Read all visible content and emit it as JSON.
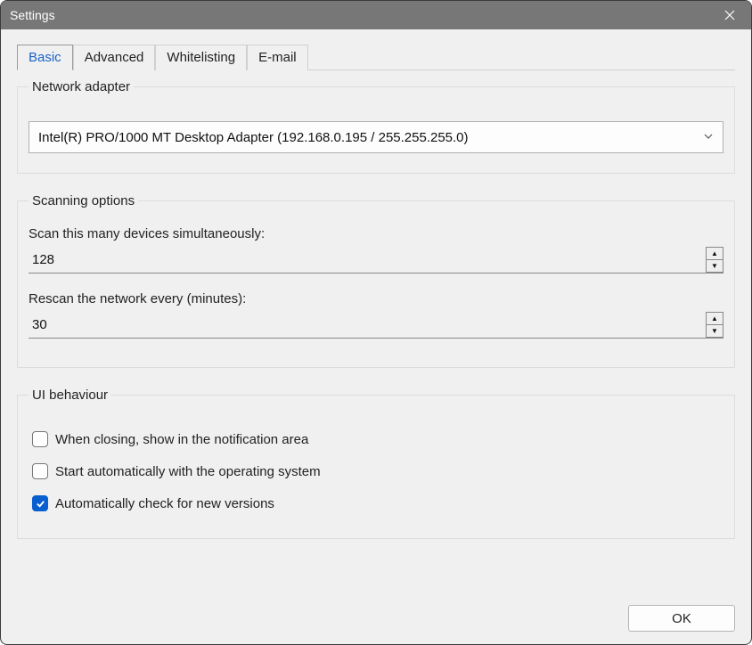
{
  "window": {
    "title": "Settings"
  },
  "tabs": {
    "basic": "Basic",
    "advanced": "Advanced",
    "whitelisting": "Whitelisting",
    "email": "E-mail"
  },
  "groups": {
    "network": {
      "legend": "Network adapter",
      "selected": "Intel(R) PRO/1000 MT Desktop Adapter (192.168.0.195 / 255.255.255.0)"
    },
    "scanning": {
      "legend": "Scanning options",
      "simultaneous_label": "Scan this many devices simultaneously:",
      "simultaneous_value": "128",
      "rescan_label": "Rescan the network every (minutes):",
      "rescan_value": "30"
    },
    "ui": {
      "legend": "UI behaviour",
      "close_tray_label": "When closing, show in the notification area",
      "close_tray_checked": false,
      "autostart_label": "Start automatically with the operating system",
      "autostart_checked": false,
      "updates_label": "Automatically check for new versions",
      "updates_checked": true
    }
  },
  "buttons": {
    "ok": "OK"
  }
}
